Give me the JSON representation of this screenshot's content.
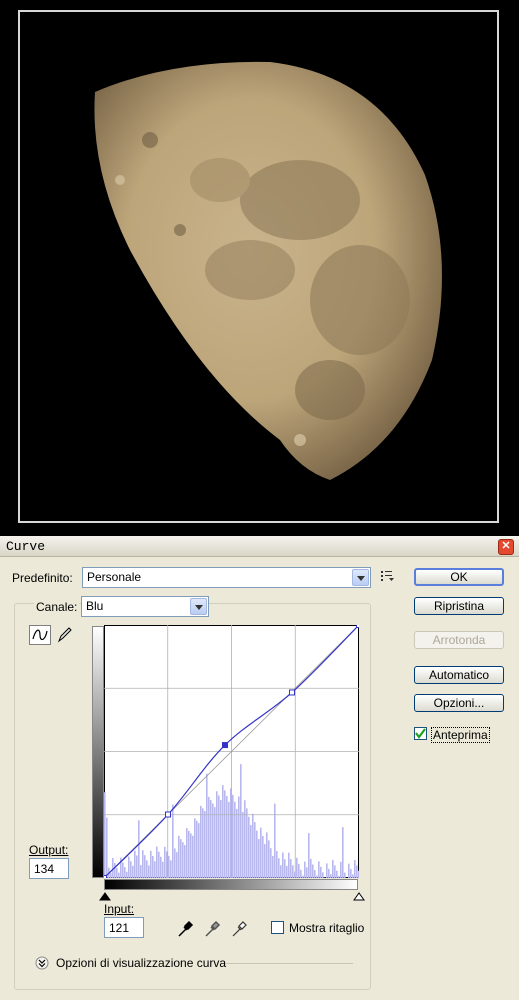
{
  "dialog": {
    "title": "Curve",
    "close_icon": "close-icon"
  },
  "preset": {
    "label": "Predefinito:",
    "value": "Personale"
  },
  "channel": {
    "label": "Canale:",
    "value": "Blu"
  },
  "buttons": {
    "ok": "OK",
    "reset": "Ripristina",
    "smooth": "Arrotonda",
    "auto": "Automatico",
    "options": "Opzioni..."
  },
  "preview": {
    "label": "Anteprima",
    "checked": true
  },
  "output": {
    "label": "Output:",
    "value": "134"
  },
  "input": {
    "label": "Input:",
    "value": "121"
  },
  "clipping": {
    "label": "Mostra ritaglio",
    "checked": false
  },
  "display_options": {
    "label": "Opzioni di visualizzazione curva"
  },
  "curve_points": [
    [
      0,
      0
    ],
    [
      64,
      64
    ],
    [
      121,
      134
    ],
    [
      188,
      187
    ],
    [
      255,
      255
    ]
  ],
  "colors": {
    "curve": "#3333c8",
    "histogram": "#b8b8ee",
    "accent": "#5a7edc"
  }
}
